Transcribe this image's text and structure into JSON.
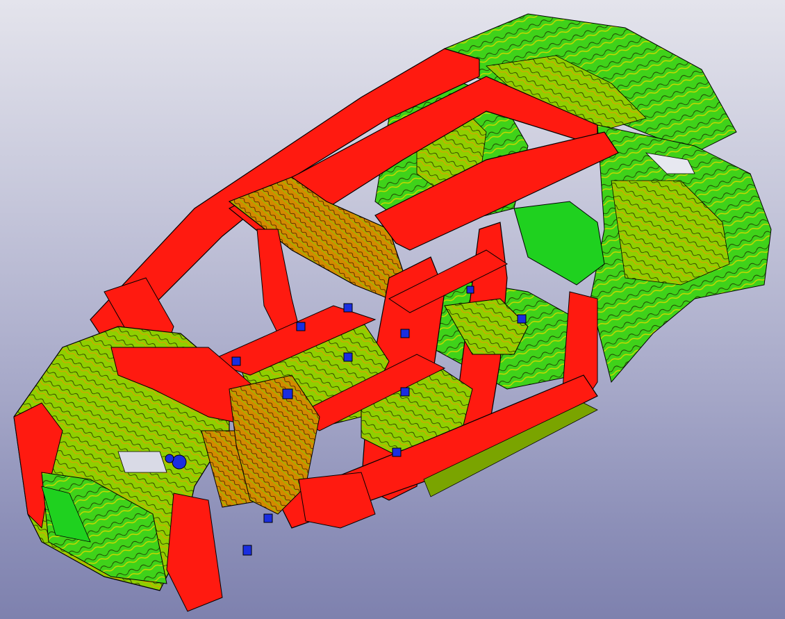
{
  "viewport": {
    "background_top": "#e4e4ec",
    "background_bottom": "#7e81ae"
  },
  "model": {
    "description_icon": "car-body-fea-mesh",
    "colors": {
      "high_stress": "#ff1a10",
      "mid_stress": "#e8a800",
      "low_mid_stress": "#a6d400",
      "low_stress": "#1fd11f",
      "edge": "#000000",
      "markers": "#1a2ee0"
    }
  }
}
